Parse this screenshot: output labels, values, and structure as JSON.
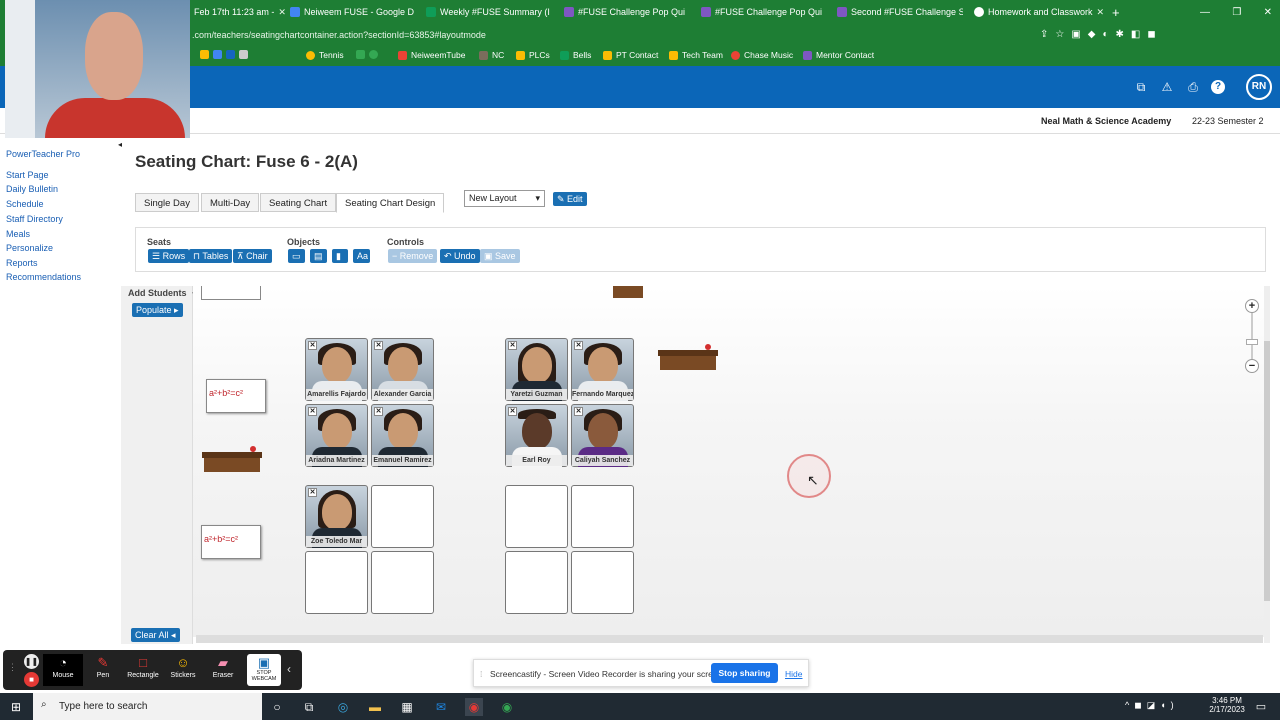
{
  "browser": {
    "tabs": [
      {
        "label": "Feb 17th 11:23 am -",
        "color": "#fbbc04"
      },
      {
        "label": "Neiweem FUSE - Google D",
        "color": "#4285f4"
      },
      {
        "label": "Weekly #FUSE Summary (I",
        "color": "#0f9d58"
      },
      {
        "label": "#FUSE Challenge Pop Qui",
        "color": "#7e57c2"
      },
      {
        "label": "#FUSE Challenge Pop Qui",
        "color": "#7e57c2"
      },
      {
        "label": "Second #FUSE Challenge S",
        "color": "#7e57c2"
      },
      {
        "label": "Homework and Classwork",
        "color": "#ffffff"
      }
    ],
    "url": ".com/teachers/seatingchartcontainer.action?sectionId=63853#layoutmode",
    "bookmarks": [
      "Tennis",
      "NeiweemTube",
      "NC",
      "PLCs",
      "Bells",
      "PT Contact",
      "Tech Team",
      "Chase Music",
      "Mentor Contact"
    ]
  },
  "header": {
    "avatar": "RN",
    "school": "Neal Math & Science Academy",
    "term": "22-23 Semester 2"
  },
  "nav": {
    "app": "PowerTeacher Pro",
    "items": [
      "Start Page",
      "Daily Bulletin",
      "Schedule",
      "Staff Directory",
      "Meals",
      "Personalize",
      "Reports",
      "Recommendations"
    ]
  },
  "page": {
    "title": "Seating Chart: Fuse 6 - 2(A)",
    "tabs": [
      "Single Day",
      "Multi-Day",
      "Seating Chart",
      "Seating Chart Design"
    ],
    "layout_select": "New Layout",
    "edit": "Edit"
  },
  "toolbox": {
    "seats_label": "Seats",
    "seats": [
      "Rows",
      "Tables",
      "Chair"
    ],
    "objects_label": "Objects",
    "objects_text_tool": "Aa",
    "controls_label": "Controls",
    "controls": [
      "Remove",
      "Undo",
      "Save"
    ]
  },
  "side": {
    "add_students": "Add Students",
    "populate": "Populate",
    "clear_all": "Clear All"
  },
  "board_text": "a²+b²=c²",
  "students": [
    "Amarellis Fajardo",
    "Alexander Garcia",
    "Ariadna Martinez",
    "Emanuel Ramirez",
    "Yaretzi Guzman",
    "Fernando Marquez",
    "Earl Roy",
    "Caliyah Sanchez",
    "Zoe Toledo Mar"
  ],
  "screencast": {
    "message": "Screencastify - Screen Video Recorder is sharing your screen.",
    "stop": "Stop sharing",
    "hide": "Hide"
  },
  "tools": [
    "Mouse",
    "Pen",
    "Rectangle",
    "Stickers",
    "Eraser",
    "STOP WEBCAM"
  ],
  "taskbar": {
    "search": "Type here to search",
    "time": "3:46 PM",
    "date": "2/17/2023"
  }
}
